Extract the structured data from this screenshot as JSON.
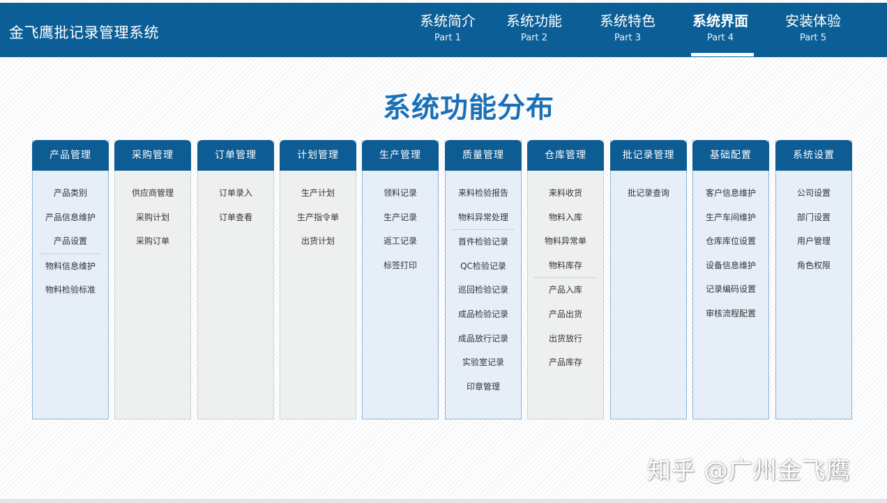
{
  "header": {
    "brand": "金飞鹰批记录管理系统",
    "nav": [
      {
        "title": "系统简介",
        "sub": "Part 1"
      },
      {
        "title": "系统功能",
        "sub": "Part 2"
      },
      {
        "title": "系统特色",
        "sub": "Part 3"
      },
      {
        "title": "系统界面",
        "sub": "Part 4",
        "active": true
      },
      {
        "title": "安装体验",
        "sub": "Part 5"
      }
    ]
  },
  "main": {
    "title": "系统功能分布",
    "columns": [
      {
        "head": "产品管理",
        "style": "blue",
        "items": [
          "产品类别",
          "产品信息维护",
          "产品设置",
          "物料信息维护",
          "物料检验标准"
        ],
        "separator_after": 2
      },
      {
        "head": "采购管理",
        "style": "gray",
        "items": [
          "供应商管理",
          "采购计划",
          "采购订单"
        ]
      },
      {
        "head": "订单管理",
        "style": "gray",
        "items": [
          "订单录入",
          "订单查看"
        ]
      },
      {
        "head": "计划管理",
        "style": "gray",
        "items": [
          "生产计划",
          "生产指令单",
          "出货计划"
        ]
      },
      {
        "head": "生产管理",
        "style": "blue",
        "items": [
          "领料记录",
          "生产记录",
          "返工记录",
          "标签打印"
        ]
      },
      {
        "head": "质量管理",
        "style": "blue",
        "items": [
          "来料检验报告",
          "物料异常处理",
          "首件检验记录",
          "QC检验记录",
          "巡回检验记录",
          "成品检验记录",
          "成品放行记录",
          "实验室记录",
          "印章管理"
        ],
        "separator_after": 1
      },
      {
        "head": "仓库管理",
        "style": "gray",
        "items": [
          "来料收货",
          "物料入库",
          "物料异常单",
          "物料库存",
          "产品入库",
          "产品出货",
          "出货放行",
          "产品库存"
        ],
        "separator_after": 3
      },
      {
        "head": "批记录管理",
        "style": "blue",
        "items": [
          "批记录查询"
        ]
      },
      {
        "head": "基础配置",
        "style": "blue",
        "items": [
          "客户信息维护",
          "生产车间维护",
          "仓库库位设置",
          "设备信息维护",
          "记录编码设置",
          "审核流程配置"
        ]
      },
      {
        "head": "系统设置",
        "style": "blue",
        "items": [
          "公司设置",
          "部门设置",
          "用户管理",
          "角色权限"
        ]
      }
    ]
  },
  "watermark": "知乎 @广州金飞鹰",
  "colors": {
    "header_bg": "#0c5f96",
    "title": "#1a70b8",
    "col_head": "#0d5c94"
  }
}
